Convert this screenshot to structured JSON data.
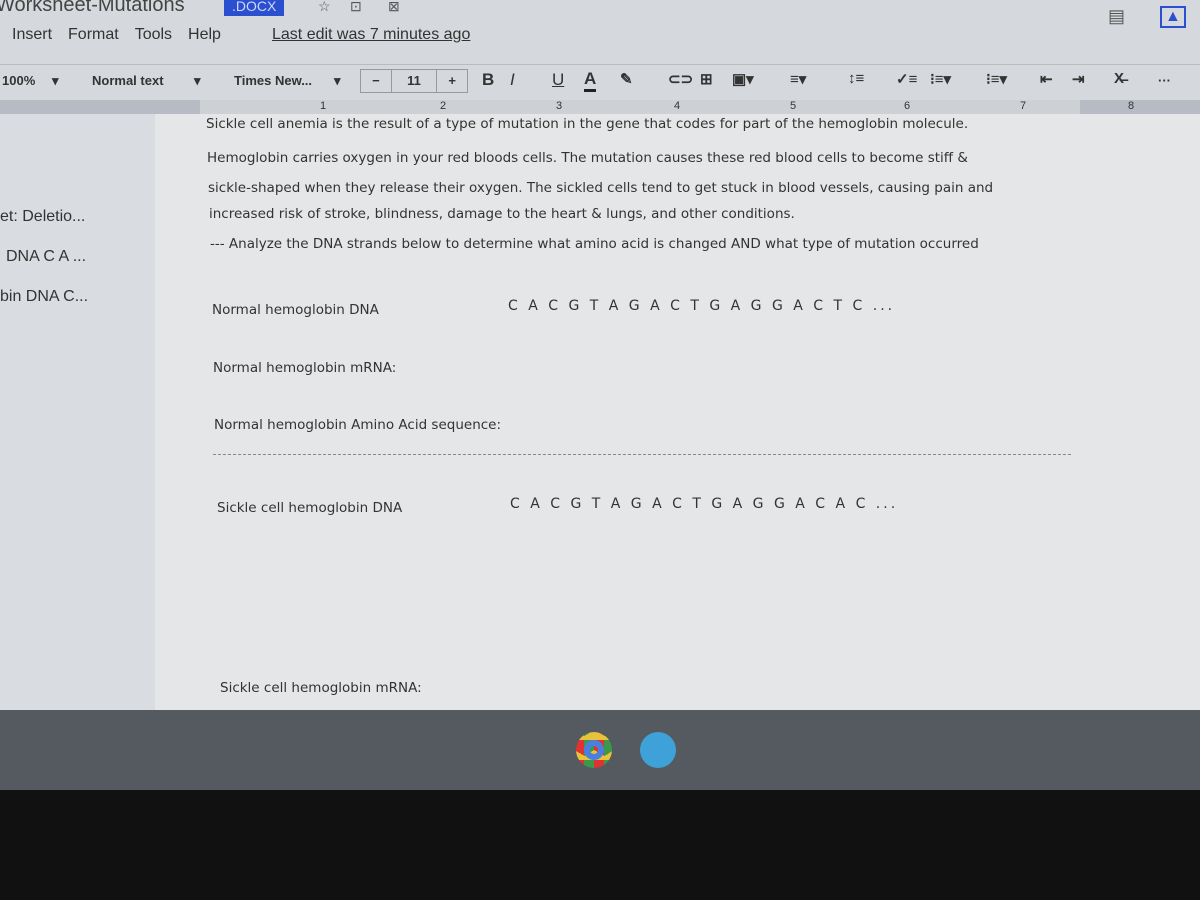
{
  "window": {
    "title": "Worksheet-Mutations",
    "badge": ".DOCX"
  },
  "menu": [
    "Insert",
    "Format",
    "Tools",
    "Help"
  ],
  "last_edit": "Last edit was 7 minutes ago",
  "toolbar": {
    "zoom": "100%",
    "style": "Normal text",
    "font": "Times New...",
    "font_size": "11",
    "minus": "−",
    "plus": "+",
    "bold": "B",
    "italic": "I",
    "underline": "U",
    "text_color": "A",
    "more": "···"
  },
  "ruler": [
    "1",
    "2",
    "3",
    "4",
    "5",
    "6",
    "7",
    "8"
  ],
  "outline": [
    "et: Deletio...",
    "DNA C A ...",
    "bin DNA C..."
  ],
  "doc": {
    "lines": [
      "Sickle cell anemia is the result of a type of mutation in the gene that codes for part of the hemoglobin molecule.",
      "Hemoglobin carries oxygen in your red bloods cells.  The mutation causes these red blood cells to become stiff &",
      "sickle-shaped when they release their oxygen.  The sickled cells tend to get stuck in blood vessels, causing pain and",
      "increased risk of stroke, blindness, damage to the heart & lungs, and other conditions.",
      "--- Analyze the DNA strands below to determine what amino acid is changed AND what type of mutation occurred"
    ],
    "normal_dna_label": "Normal hemoglobin DNA",
    "normal_dna": "C A C G T A G A C T G A G G A C T C ...",
    "normal_mrna_label": "Normal hemoglobin mRNA:",
    "normal_aa_label": "Normal hemoglobin Amino Acid sequence:",
    "sickle_dna_label": "Sickle cell hemoglobin DNA",
    "sickle_dna": "C A C G T A G A C T G A G G A C A C ...",
    "sickle_mrna_label": "Sickle cell hemoglobin mRNA:"
  },
  "shelf": [
    "chrome-icon",
    "meet-icon"
  ]
}
